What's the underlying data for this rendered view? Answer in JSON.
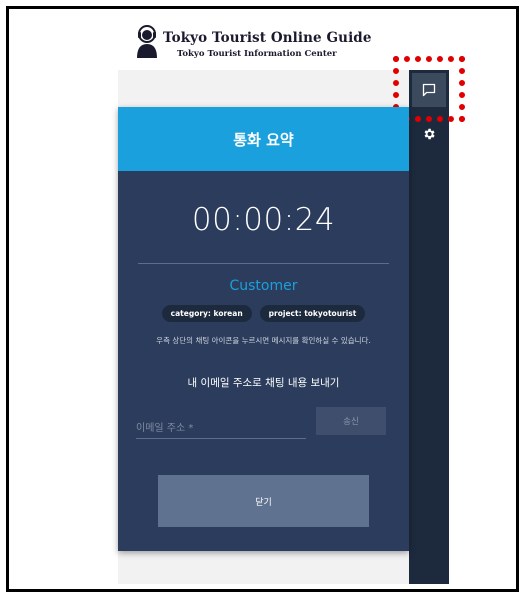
{
  "logo": {
    "title": "Tokyo Tourist Online Guide",
    "subtitle": "Tokyo Tourist Information Center"
  },
  "sidebar": {
    "chat_icon": "chat-bubble-icon",
    "settings_icon": "gear-icon"
  },
  "modal": {
    "title": "통화 요약",
    "timer": "00:00:24",
    "customer_label": "Customer",
    "tags": [
      "category: korean",
      "project: tokyotourist"
    ],
    "info_text": "우측 상단의 채팅 아이콘을 누르시면 메시지를 확인하실 수 있습니다.",
    "email_heading": "내 이메일 주소로 채팅 내용 보내기",
    "email_placeholder": "이메일 주소 *",
    "email_value": "",
    "send_label": "송신",
    "close_label": "닫기"
  },
  "colors": {
    "header_blue": "#1aa0dc",
    "modal_bg": "#2c3c5c",
    "sidebar_bg": "#1d2a3e",
    "highlight_red": "#e00000"
  }
}
